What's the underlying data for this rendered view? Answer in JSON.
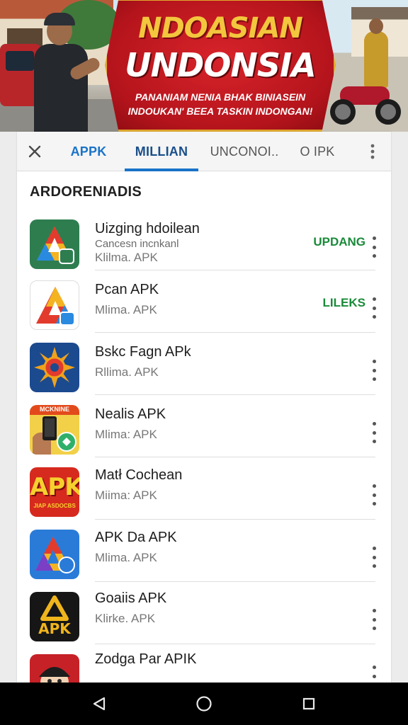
{
  "banner": {
    "title_line1": "NDOASIAN",
    "title_line2": "UNDONSIA",
    "subtitle_line1": "PANANIAM NENIA BHAK BINIASEIN",
    "subtitle_line2": "INDOUKAN' BEEA TASKIN INDONGAN!"
  },
  "tabs": {
    "close_icon": "close-icon",
    "items": [
      "APPK",
      "MILLIAN",
      "UNCONOI..",
      "O IPK"
    ],
    "active_index": 1,
    "active_color": "#1a73c8"
  },
  "section_title": "ARDORENIADIS",
  "apps": [
    {
      "name": "Uizging hdoilean",
      "subtitle": "Cancesn incnkanl",
      "meta": "Klilma. APK",
      "action": "UPDANG",
      "icon": "play-triangle-icon"
    },
    {
      "name": "Pcan APK",
      "subtitle": "",
      "meta": "Mlima. APK",
      "action": "LILEKS",
      "icon": "play-triangle-icon"
    },
    {
      "name": "Bskc Fagn APk",
      "subtitle": "",
      "meta": "Rllima. APK",
      "action": "",
      "icon": "sun-icon"
    },
    {
      "name": "Nealis APK",
      "subtitle": "",
      "meta": "Mlima: APK",
      "action": "",
      "icon": "hand-phone-icon",
      "icon_text": "MCKNINE"
    },
    {
      "name": "Matł Cochean",
      "subtitle": "",
      "meta": "Miima: APK",
      "action": "",
      "icon": "apk-logo-icon",
      "icon_text": "APK",
      "icon_subtext": "JIAP ASDOCBS"
    },
    {
      "name": "APK Da APK",
      "subtitle": "",
      "meta": "Mlima. APK",
      "action": "",
      "icon": "play-triangle-icon"
    },
    {
      "name": "Goaiis APK",
      "subtitle": "",
      "meta": "Klirke. APK",
      "action": "",
      "icon": "apk-triangle-icon",
      "icon_text": "APK"
    },
    {
      "name": "Zodga Par APIK",
      "subtitle": "",
      "meta": "",
      "action": "",
      "icon": "face-icon"
    }
  ],
  "colors": {
    "action_green": "#1a8a3a",
    "banner_red": "#c81a22",
    "banner_gold": "#f3c63d"
  },
  "navbar": {
    "icons": [
      "back-icon",
      "home-icon",
      "recents-icon"
    ]
  }
}
